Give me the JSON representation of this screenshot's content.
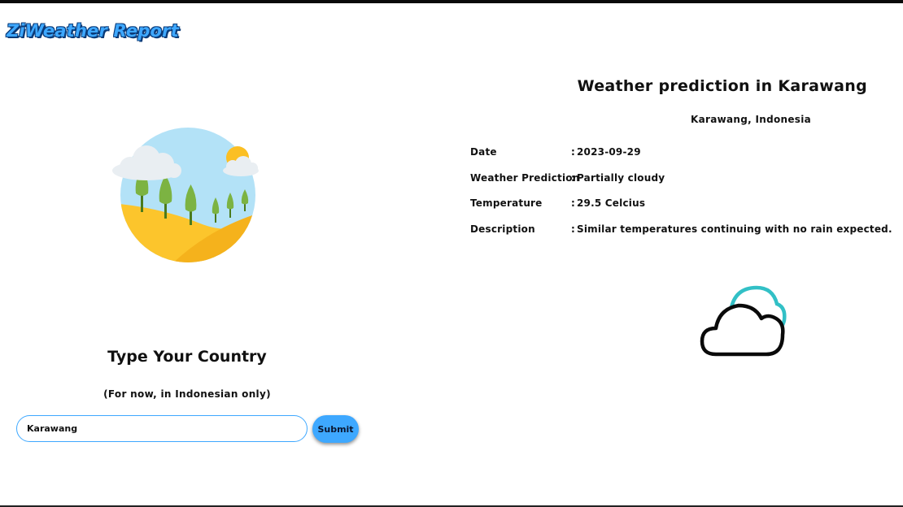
{
  "header": {
    "brand": "ZiWeather Report"
  },
  "illustration": {
    "icon": "landscape-illustration"
  },
  "form": {
    "title": "Type Your Country",
    "subtitle": "(For now, in Indonesian only)",
    "input_value": "Karawang",
    "submit_label": "Submit"
  },
  "prediction": {
    "title": "Weather prediction in Karawang",
    "location": "Karawang, Indonesia",
    "rows": [
      {
        "label": "Date",
        "value": "2023-09-29"
      },
      {
        "label": "Weather Prediction",
        "value": "Partially cloudy"
      },
      {
        "label": "Temperature",
        "value": "29.5 Celcius"
      },
      {
        "label": "Description",
        "value": "Similar temperatures continuing with no rain expected."
      }
    ],
    "separator": ":",
    "icon": "partly-cloudy-icon"
  },
  "colors": {
    "accent": "#3ea8ff",
    "brand_outline": "#0b3b78",
    "sky": "#b3e2f7",
    "sand": "#fcc52c",
    "tree": "#7cb342",
    "sun": "#fbbf24",
    "cloud_teal": "#32c0c6"
  }
}
